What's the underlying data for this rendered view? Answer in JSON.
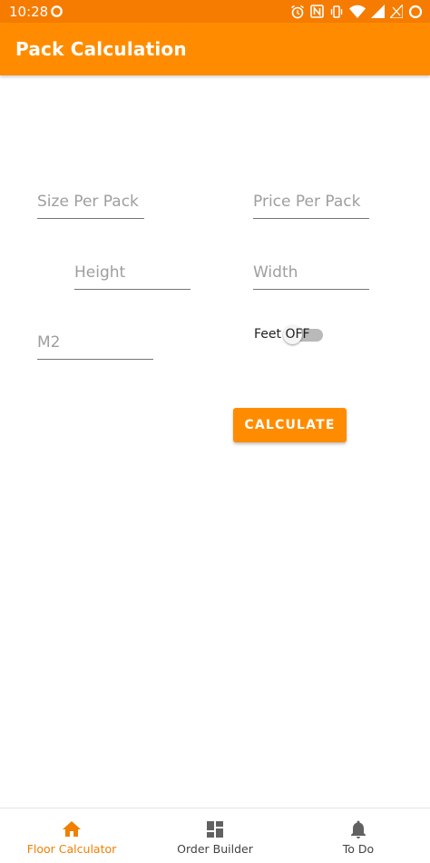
{
  "status_bar": {
    "time": "10:28"
  },
  "app_bar": {
    "title": "Pack Calculation"
  },
  "form": {
    "size_per_pack_placeholder": "Size Per Pack",
    "price_per_pack_placeholder": "Price Per Pack",
    "height_placeholder": "Height",
    "width_placeholder": "Width",
    "m2_placeholder": "M2",
    "feet_label": "Feet",
    "feet_state_text": "OFF",
    "feet_toggle_on": false,
    "calculate_label": "CALCULATE"
  },
  "bottom_nav": {
    "items": [
      {
        "label": "Floor Calculator",
        "icon": "home-icon",
        "active": true
      },
      {
        "label": "Order Builder",
        "icon": "dashboard-icon",
        "active": false
      },
      {
        "label": "To Do",
        "icon": "bell-icon",
        "active": false
      }
    ]
  },
  "colors": {
    "accent": "#ff8c00",
    "status_bar": "#f57c00",
    "active_nav": "#f08000"
  }
}
